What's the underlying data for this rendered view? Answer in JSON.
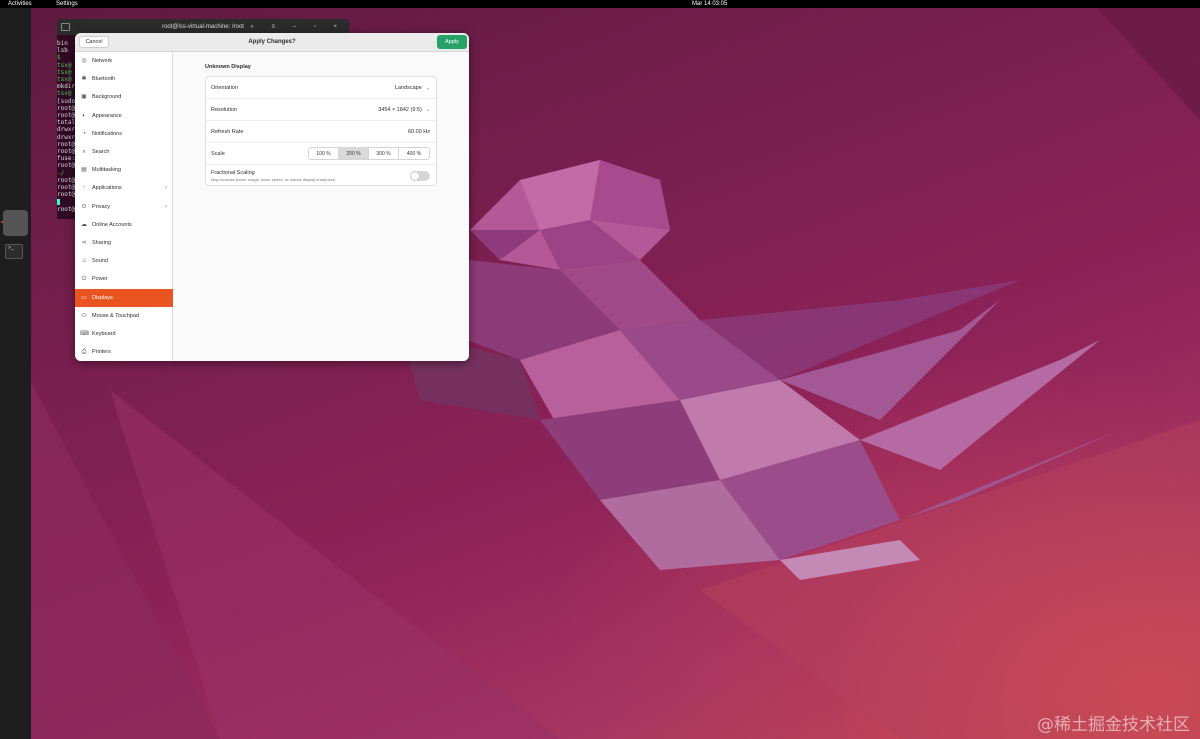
{
  "topbar": {
    "activities": "Activities",
    "app_name": "Settings",
    "clock": "Mar 14  03:05"
  },
  "terminal": {
    "title": "root@lss-virtual-machine: /root",
    "lines": [
      "bin",
      "lsb",
      "$",
      "tsx@",
      "tsx@",
      "tsx@",
      "mkdir",
      "tsx@",
      "[sudo",
      "root@",
      "root@",
      "total",
      "drwxr",
      "drwxr",
      "root@",
      "root@",
      "fuse:",
      "root@",
      "-/",
      "root@",
      "root@",
      "root@",
      "",
      "root@"
    ]
  },
  "settings": {
    "header": {
      "cancel_label": "Cancel",
      "title": "Apply Changes?",
      "apply_label": "Apply"
    },
    "sidebar": [
      {
        "label": "Network",
        "icon": "network-icon"
      },
      {
        "label": "Bluetooth",
        "icon": "bluetooth-icon"
      },
      {
        "label": "Background",
        "icon": "background-icon"
      },
      {
        "label": "Appearance",
        "icon": "appearance-icon"
      },
      {
        "label": "Notifications",
        "icon": "bell-icon"
      },
      {
        "label": "Search",
        "icon": "search-icon"
      },
      {
        "label": "Multitasking",
        "icon": "multitasking-icon"
      },
      {
        "label": "Applications",
        "icon": "applications-icon"
      },
      {
        "label": "Privacy",
        "icon": "lock-icon"
      },
      {
        "label": "Online Accounts",
        "icon": "cloud-icon"
      },
      {
        "label": "Sharing",
        "icon": "share-icon"
      },
      {
        "label": "Sound",
        "icon": "music-note-icon"
      },
      {
        "label": "Power",
        "icon": "power-icon"
      },
      {
        "label": "Displays",
        "icon": "display-icon"
      },
      {
        "label": "Mouse & Touchpad",
        "icon": "mouse-icon"
      },
      {
        "label": "Keyboard",
        "icon": "keyboard-icon"
      },
      {
        "label": "Printers",
        "icon": "printer-icon"
      }
    ],
    "selected_item": "Displays",
    "display": {
      "title": "Unknown Display",
      "orientation_label": "Orientation",
      "orientation_value": "Landscape",
      "resolution_label": "Resolution",
      "resolution_value": "3454 × 1842 (9:5)",
      "refresh_label": "Refresh Rate",
      "refresh_value": "60.00 Hz",
      "scale_label": "Scale",
      "scale_options": [
        "100 %",
        "200 %",
        "300 %",
        "400 %"
      ],
      "scale_selected": "200 %",
      "fractional_label": "Fractional Scaling",
      "fractional_desc": "May increase power usage, lower speed, or reduce display sharpness.",
      "fractional_enabled": false
    }
  },
  "watermark": "@稀土掘金技术社区",
  "colors": {
    "accent": "#e95420",
    "apply": "#26a269"
  }
}
